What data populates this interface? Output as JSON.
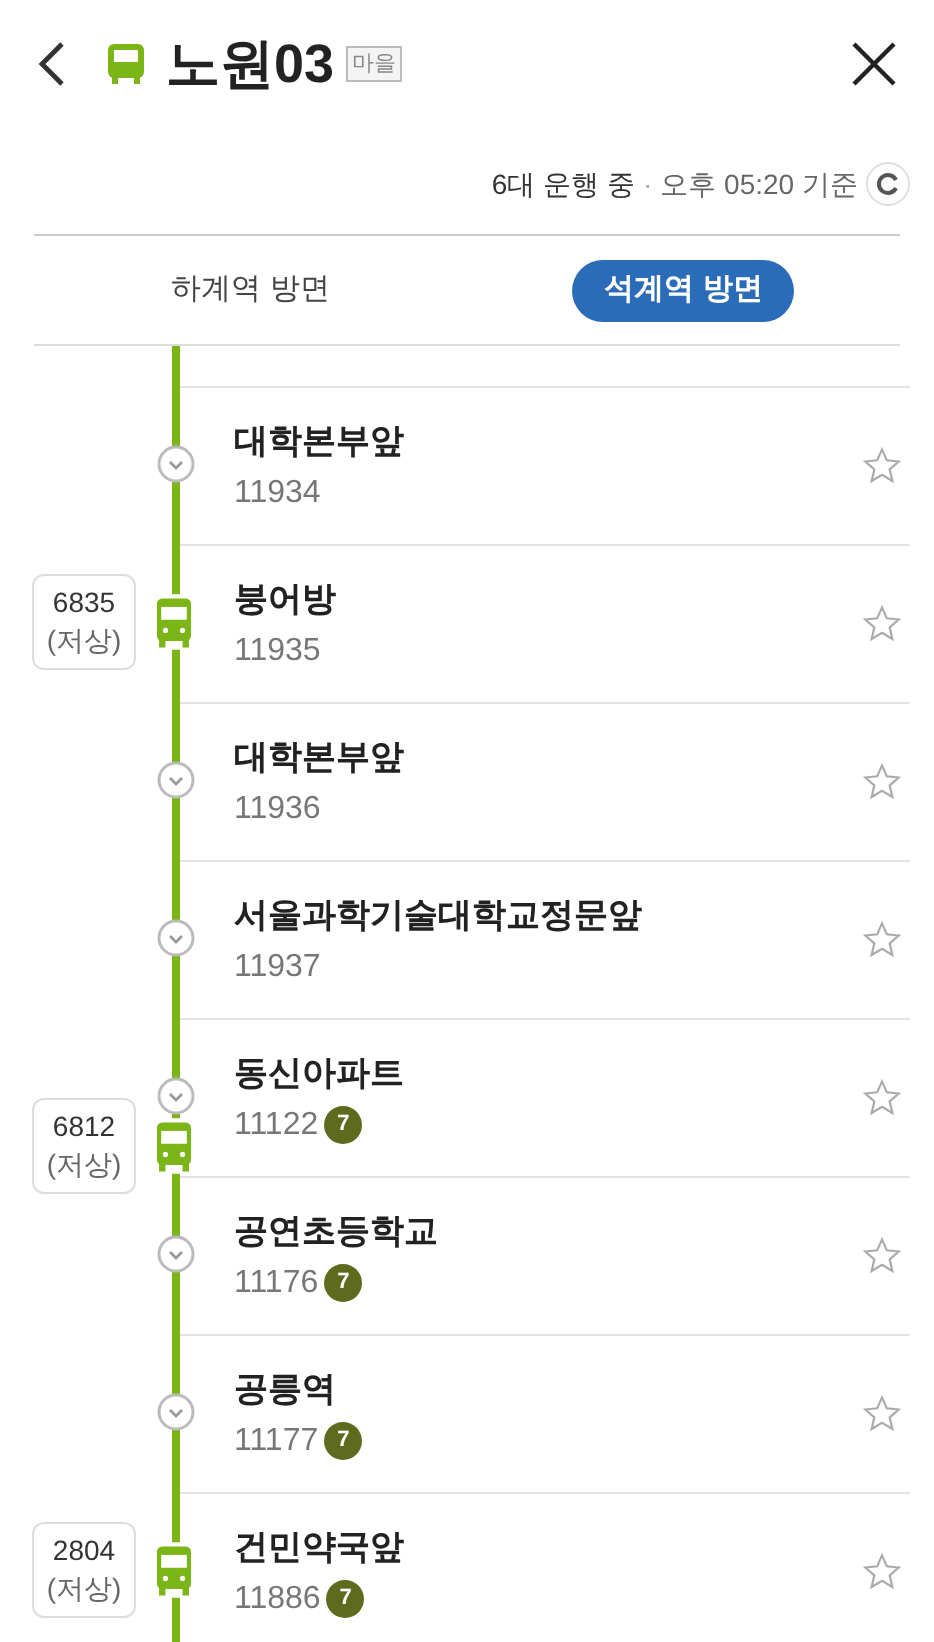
{
  "header": {
    "title": "노원03",
    "tag": "마을"
  },
  "status": {
    "count": "6대 운행 중",
    "separator": "·",
    "time": "오후 05:20 기준"
  },
  "tabs": [
    {
      "label": "하계역 방면",
      "selected": false
    },
    {
      "label": "석계역 방면",
      "selected": true
    }
  ],
  "stops": [
    {
      "name": "대학본부앞",
      "code": "11934",
      "favorite": false
    },
    {
      "name": "붕어방",
      "code": "11935",
      "favorite": false,
      "bus": {
        "number": "6835",
        "note": "(저상)",
        "kind": "at"
      }
    },
    {
      "name": "대학본부앞",
      "code": "11936",
      "favorite": false
    },
    {
      "name": "서울과학기술대학교정문앞",
      "code": "11937",
      "favorite": false
    },
    {
      "name": "동신아파트",
      "code": "11122",
      "transfer": "7",
      "favorite": false,
      "bus": {
        "number": "6812",
        "note": "(저상)",
        "kind": "leaving"
      }
    },
    {
      "name": "공연초등학교",
      "code": "11176",
      "transfer": "7",
      "favorite": false
    },
    {
      "name": "공릉역",
      "code": "11177",
      "transfer": "7",
      "favorite": false
    },
    {
      "name": "건민약국앞",
      "code": "11886",
      "transfer": "7",
      "favorite": false,
      "bus": {
        "number": "2804",
        "note": "(저상)",
        "kind": "at"
      }
    }
  ]
}
